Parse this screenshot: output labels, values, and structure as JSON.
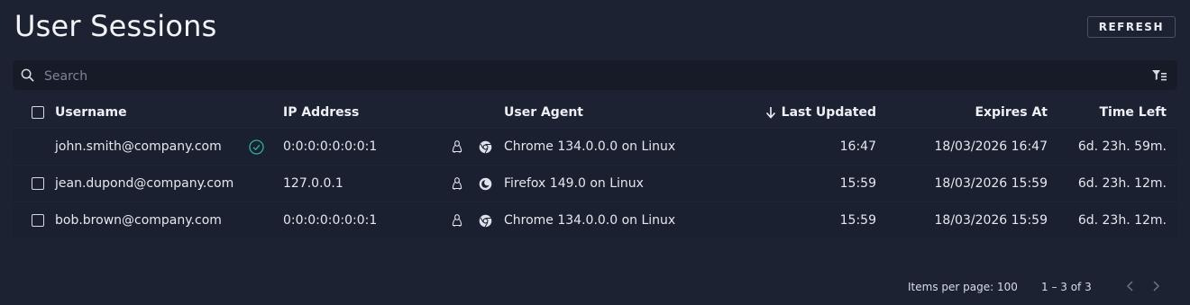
{
  "page": {
    "title": "User Sessions",
    "refresh_label": "REFRESH"
  },
  "search": {
    "placeholder": "Search"
  },
  "table": {
    "columns": {
      "username": "Username",
      "ip": "IP Address",
      "user_agent": "User Agent",
      "last_updated": "Last Updated",
      "expires_at": "Expires At",
      "time_left": "Time Left"
    },
    "sort": {
      "column": "Last Updated",
      "direction": "descending"
    },
    "rows": [
      {
        "username": "john.smith@company.com",
        "current_session": true,
        "ip": "0:0:0:0:0:0:0:1",
        "os_icon": "linux-icon",
        "browser_icon": "chrome-icon",
        "user_agent": "Chrome 134.0.0.0 on Linux",
        "last_updated": "16:47",
        "expires_at": "18/03/2026 16:47",
        "time_left": "6d. 23h. 59m."
      },
      {
        "username": "jean.dupond@company.com",
        "current_session": false,
        "ip": "127.0.0.1",
        "os_icon": "linux-icon",
        "browser_icon": "firefox-icon",
        "user_agent": "Firefox 149.0 on Linux",
        "last_updated": "15:59",
        "expires_at": "18/03/2026 15:59",
        "time_left": "6d. 23h. 12m."
      },
      {
        "username": "bob.brown@company.com",
        "current_session": false,
        "ip": "0:0:0:0:0:0:0:1",
        "os_icon": "linux-icon",
        "browser_icon": "chrome-icon",
        "user_agent": "Chrome 134.0.0.0 on Linux",
        "last_updated": "15:59",
        "expires_at": "18/03/2026 15:59",
        "time_left": "6d. 23h. 12m."
      }
    ]
  },
  "pagination": {
    "items_per_page": "Items per page: 100",
    "range": "1 – 3 of 3"
  },
  "colors": {
    "background": "#1c2232",
    "row": "#1a2030",
    "success": "#2bb3a0"
  }
}
